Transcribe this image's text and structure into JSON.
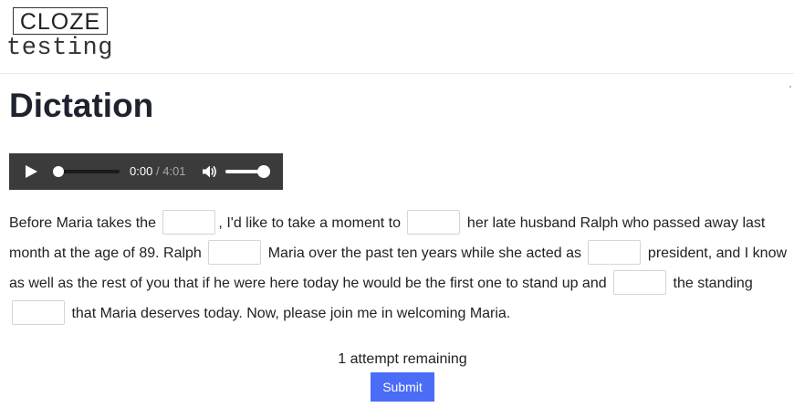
{
  "logo": {
    "top_text": "CLOZE",
    "bottom_text": "testing"
  },
  "page": {
    "title": "Dictation"
  },
  "audio": {
    "current_time": "0:00",
    "separator": "/",
    "duration": "4:01",
    "progress": 0,
    "volume": 1.0
  },
  "passage": {
    "segments": [
      "Before Maria takes the",
      ", I'd like to take a moment to",
      "her late husband Ralph who passed away last month at the age of 89. Ralph",
      "Maria over the past ten years while she acted as",
      "president, and I know as well as the rest of you that if he were here today he would be the first one to stand up and",
      "the standing",
      "that Maria deserves today. Now, please join me in welcoming Maria."
    ],
    "blanks": [
      "",
      "",
      "",
      "",
      "",
      ""
    ]
  },
  "status": {
    "attempts_text": "1 attempt remaining"
  },
  "actions": {
    "submit_label": "Submit"
  },
  "colors": {
    "primary": "#4a6cf7",
    "title": "#1f2330",
    "player_bg": "#3b3b3b"
  }
}
